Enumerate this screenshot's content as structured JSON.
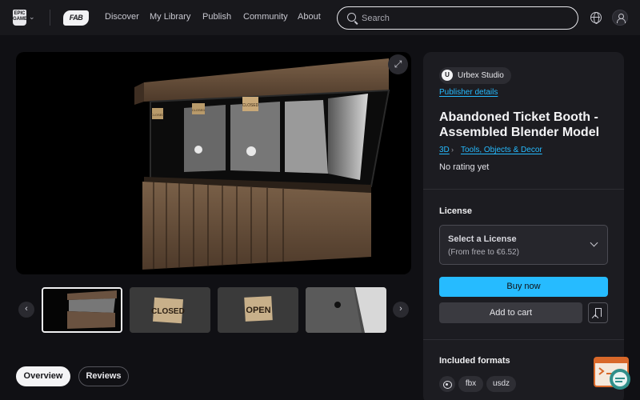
{
  "nav": {
    "links": [
      "Discover",
      "My Library",
      "Publish",
      "Community",
      "About"
    ],
    "search_placeholder": "Search",
    "epic_logo": "EPIC GAMES",
    "fab_logo": "FAB"
  },
  "viewer": {
    "signs": [
      "CLOSED",
      "CLOSED",
      "CLOSED"
    ]
  },
  "thumbnails": {
    "signs": [
      "CLOSED",
      "OPEN"
    ]
  },
  "tabs": {
    "overview": "Overview",
    "reviews": "Reviews"
  },
  "product": {
    "publisher": "Urbex Studio",
    "publisher_initial": "U",
    "publisher_details": "Publisher details",
    "title": "Abandoned Ticket Booth - Assembled Blender Model",
    "breadcrumb": [
      "3D",
      "Tools, Objects & Decor"
    ],
    "rating": "No rating yet"
  },
  "license": {
    "heading": "License",
    "select_label": "Select a License",
    "price_hint": "(From free to €6.52)"
  },
  "actions": {
    "buy": "Buy now",
    "add_to_cart": "Add to cart"
  },
  "formats": {
    "heading": "Included formats",
    "items": [
      "fbx",
      "usdz"
    ]
  },
  "colors": {
    "accent": "#26bbff",
    "background": "#101014",
    "panel": "#1c1c21"
  }
}
